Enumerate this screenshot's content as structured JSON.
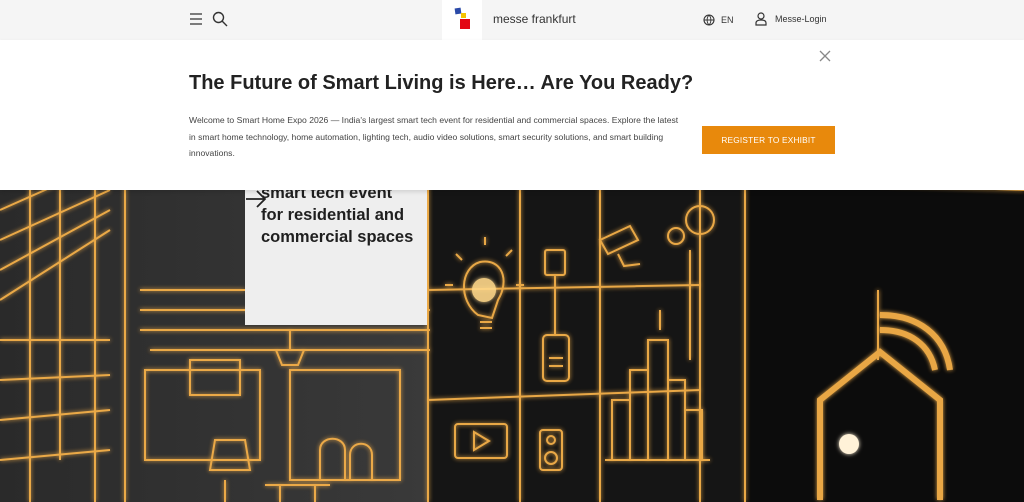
{
  "header": {
    "menu_icon": "hamburger-menu-icon",
    "search_icon": "search-icon",
    "brand_name": "messe frankfurt",
    "language_icon": "globe-icon",
    "language": "EN",
    "login_icon": "user-icon",
    "login_label": "Messe-Login"
  },
  "banner": {
    "title": "The Future of Smart Living is Here… Are You Ready?",
    "description": "Welcome to Smart Home Expo 2026 — India's largest smart tech event for residential and commercial spaces. Explore the latest in smart home technology, home automation, lighting tech, audio video solutions, smart security solutions, and smart building innovations.",
    "cta_label": "REGISTER TO EXHIBIT",
    "close_icon": "close-icon"
  },
  "hero": {
    "text": "smart tech event\nfor residential and\ncommercial spaces",
    "arrow_icon": "arrow-right-icon"
  },
  "colors": {
    "accent": "#e8890c",
    "glow": "#f5b04a",
    "header_bg": "#f5f5f5",
    "hero_bg": "#111111"
  }
}
